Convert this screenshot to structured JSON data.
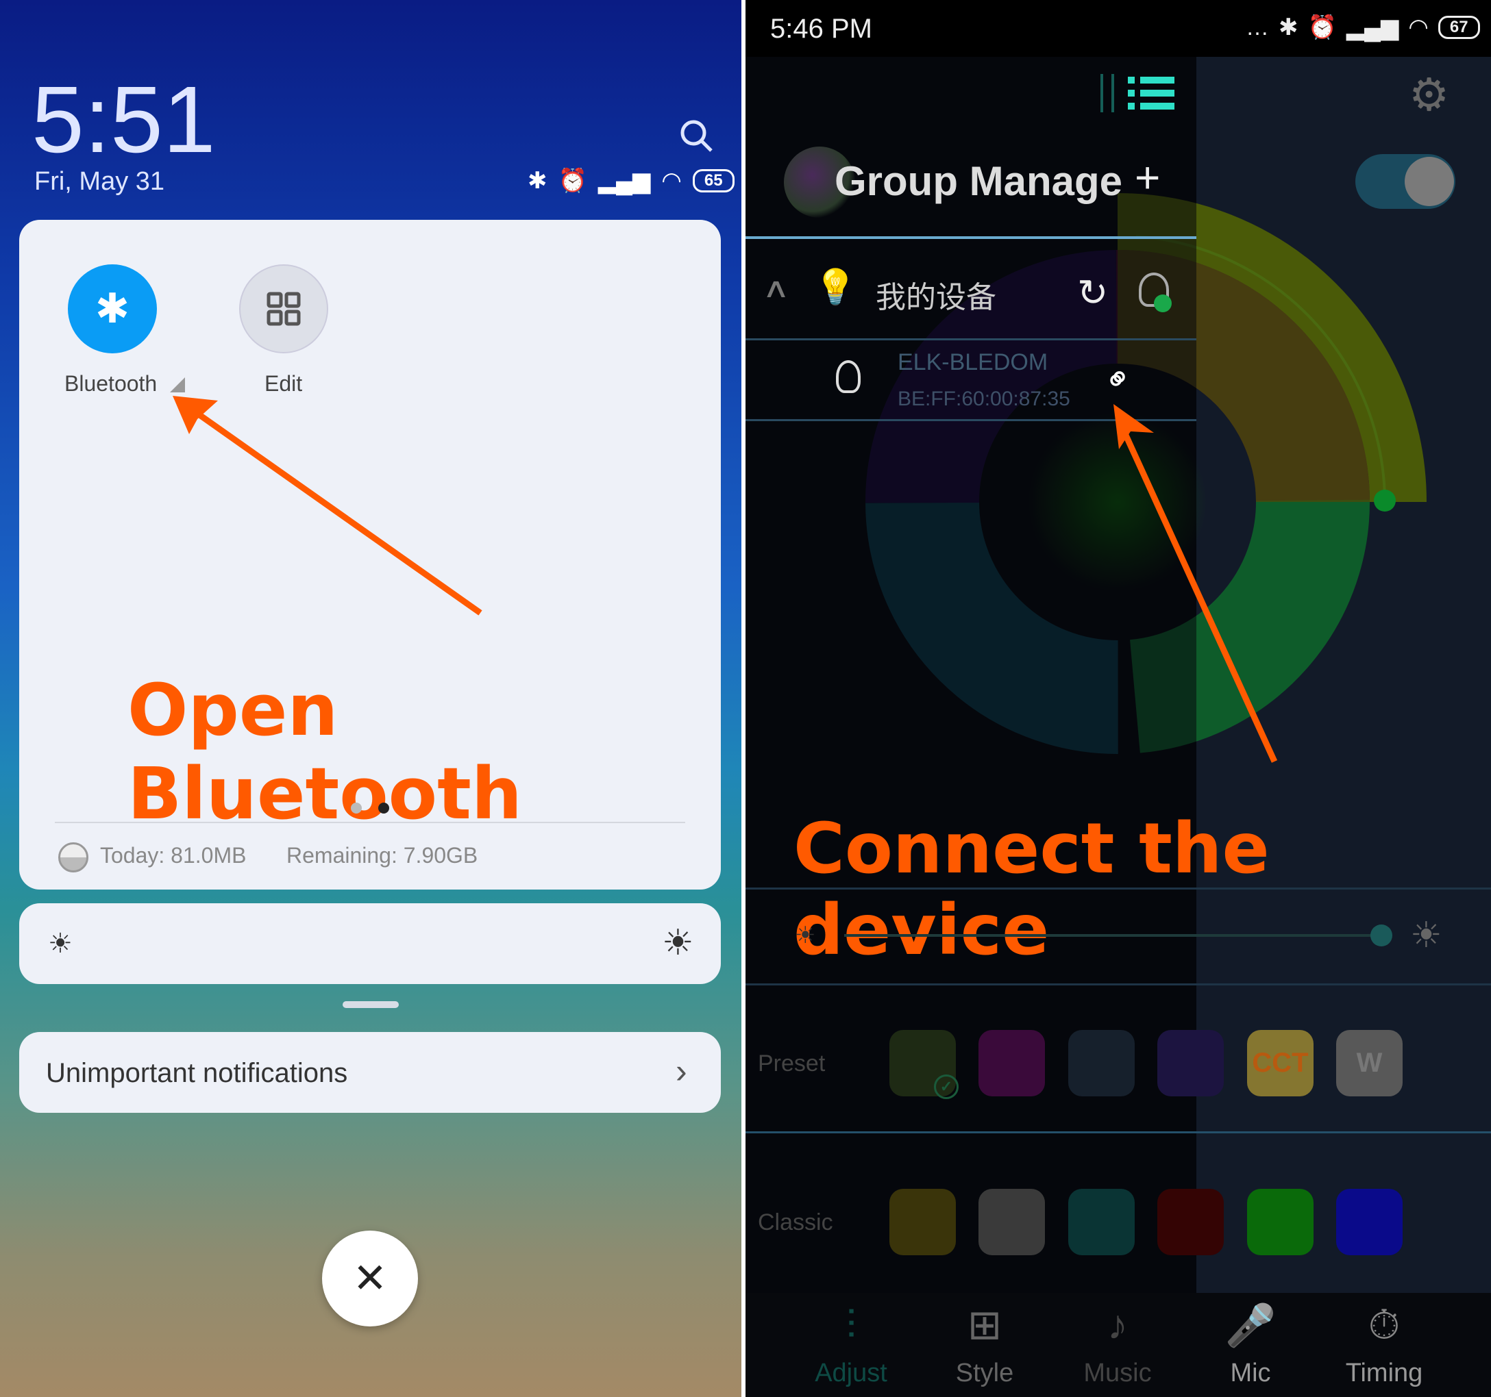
{
  "left_screen": {
    "clock": "5:51",
    "date": "Fri, May 31",
    "battery": "65",
    "toggles": [
      {
        "label": "Bluetooth",
        "icon": "bluetooth-icon",
        "active": true
      },
      {
        "label": "Edit",
        "icon": "grid-icon",
        "active": false
      }
    ],
    "annotation": "Open Bluetooth",
    "page_indicator": {
      "pages": 2,
      "current": 2
    },
    "data_usage": {
      "today": "Today: 81.0MB",
      "remaining": "Remaining: 7.90GB"
    },
    "notifications_label": "Unimportant notifications",
    "accent": "#0a9cf5",
    "annotation_color": "#ff5a00"
  },
  "right_screen": {
    "status_time": "5:46 PM",
    "battery": "67",
    "drawer": {
      "title": "Group Manage",
      "add": "+",
      "group_name": "我的设备",
      "device": {
        "name": "ELK-BLEDOM",
        "mac": "BE:FF:60:00:87:35"
      }
    },
    "annotation": "Connect the device",
    "preset": {
      "label": "Preset",
      "swatches": [
        {
          "color": "#1e2a14",
          "text": "",
          "selected": true
        },
        {
          "color": "#3a0a3a",
          "text": ""
        },
        {
          "color": "#16202c",
          "text": ""
        },
        {
          "color": "#1c1440",
          "text": ""
        },
        {
          "color": "#857630",
          "text": "CCT"
        },
        {
          "color": "#585858",
          "text": "W"
        }
      ]
    },
    "classic": {
      "label": "Classic",
      "swatches": [
        "#3a340a",
        "#3a3a3a",
        "#0a3434",
        "#340404",
        "#0a6a0a",
        "#0a0a8a"
      ]
    },
    "tabs": [
      {
        "label": "Adjust",
        "icon": "sliders-icon",
        "active": true
      },
      {
        "label": "Style",
        "icon": "grid-icon"
      },
      {
        "label": "Music",
        "icon": "music-icon"
      },
      {
        "label": "Mic",
        "icon": "mic-icon"
      },
      {
        "label": "Timing",
        "icon": "timer-icon"
      }
    ],
    "accent": "#2ee0c8"
  }
}
